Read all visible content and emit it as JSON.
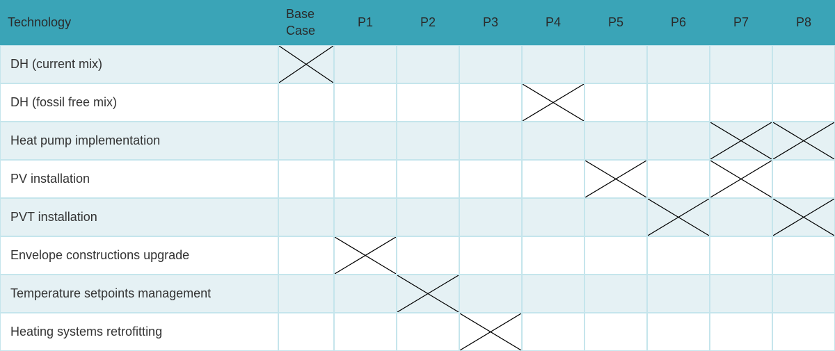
{
  "chart_data": {
    "type": "table",
    "title": "",
    "columns": [
      "Technology",
      "Base Case",
      "P1",
      "P2",
      "P3",
      "P4",
      "P5",
      "P6",
      "P7",
      "P8"
    ],
    "rows": [
      {
        "tech": "DH (current mix)",
        "marks": [
          "Base Case"
        ]
      },
      {
        "tech": "DH (fossil free mix)",
        "marks": [
          "P4"
        ]
      },
      {
        "tech": "Heat pump implementation",
        "marks": [
          "P7",
          "P8"
        ]
      },
      {
        "tech": "PV installation",
        "marks": [
          "P5",
          "P7"
        ]
      },
      {
        "tech": "PVT installation",
        "marks": [
          "P6",
          "P8"
        ]
      },
      {
        "tech": "Envelope constructions upgrade",
        "marks": [
          "P1"
        ]
      },
      {
        "tech": "Temperature setpoints management",
        "marks": [
          "P2"
        ]
      },
      {
        "tech": "Heating systems retrofitting",
        "marks": [
          "P3"
        ]
      }
    ]
  },
  "layout": {
    "col_widths": [
      "400px",
      "80px",
      "90px",
      "90px",
      "90px",
      "90px",
      "90px",
      "90px",
      "90px",
      "90px"
    ]
  }
}
